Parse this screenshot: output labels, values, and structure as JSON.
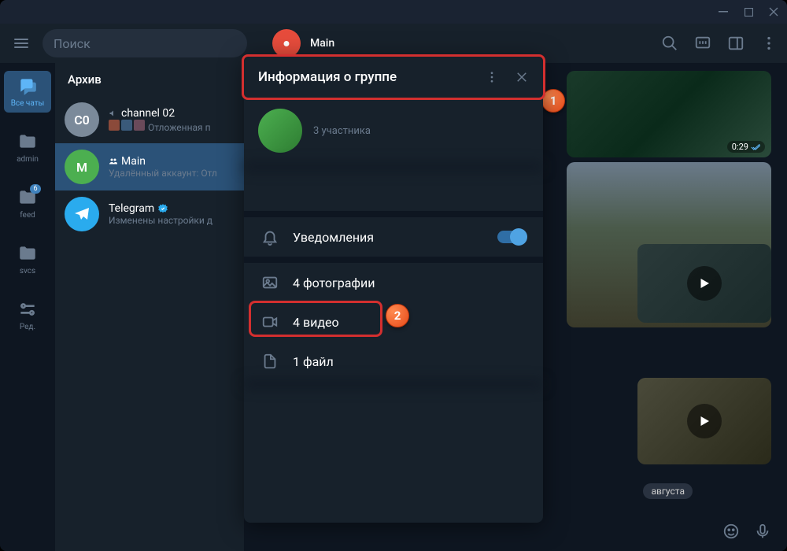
{
  "titlebar": {
    "minimize": "—",
    "maximize": "▢",
    "close": "✕"
  },
  "search": {
    "placeholder": "Поиск"
  },
  "chat_header": {
    "title": "Main"
  },
  "tabs": [
    {
      "id": "all",
      "label": "Все чаты",
      "active": true
    },
    {
      "id": "admin",
      "label": "admin"
    },
    {
      "id": "feed",
      "label": "feed",
      "badge": "6"
    },
    {
      "id": "svcs",
      "label": "svcs"
    },
    {
      "id": "edit",
      "label": "Ред."
    }
  ],
  "archive_label": "Архив",
  "chats": [
    {
      "id": "c0",
      "avatar_text": "C0",
      "avatar_color": "#7b8a9a",
      "name": "channel 02",
      "preview": "Отложенная п",
      "name_icon": "megaphone"
    },
    {
      "id": "main",
      "avatar_text": "M",
      "avatar_color": "#4caf50",
      "name": "Main",
      "preview": "Удалённый аккаунт: Отл",
      "name_icon": "group",
      "selected": true
    },
    {
      "id": "tg",
      "avatar_text": "",
      "avatar_color": "#2aabee",
      "name": "Telegram",
      "preview": "Изменены настройки д",
      "verified": true
    }
  ],
  "modal": {
    "title": "Информация о группе",
    "members": "3 участника",
    "notifications_label": "Уведомления",
    "media": [
      {
        "icon": "photo",
        "label": "4 фотографии"
      },
      {
        "icon": "video",
        "label": "4 видео",
        "highlighted": true
      },
      {
        "icon": "file",
        "label": "1 файл"
      }
    ]
  },
  "messages": {
    "video1_duration": "0:29",
    "date_label": "августа"
  },
  "callouts": {
    "one": "1",
    "two": "2"
  }
}
